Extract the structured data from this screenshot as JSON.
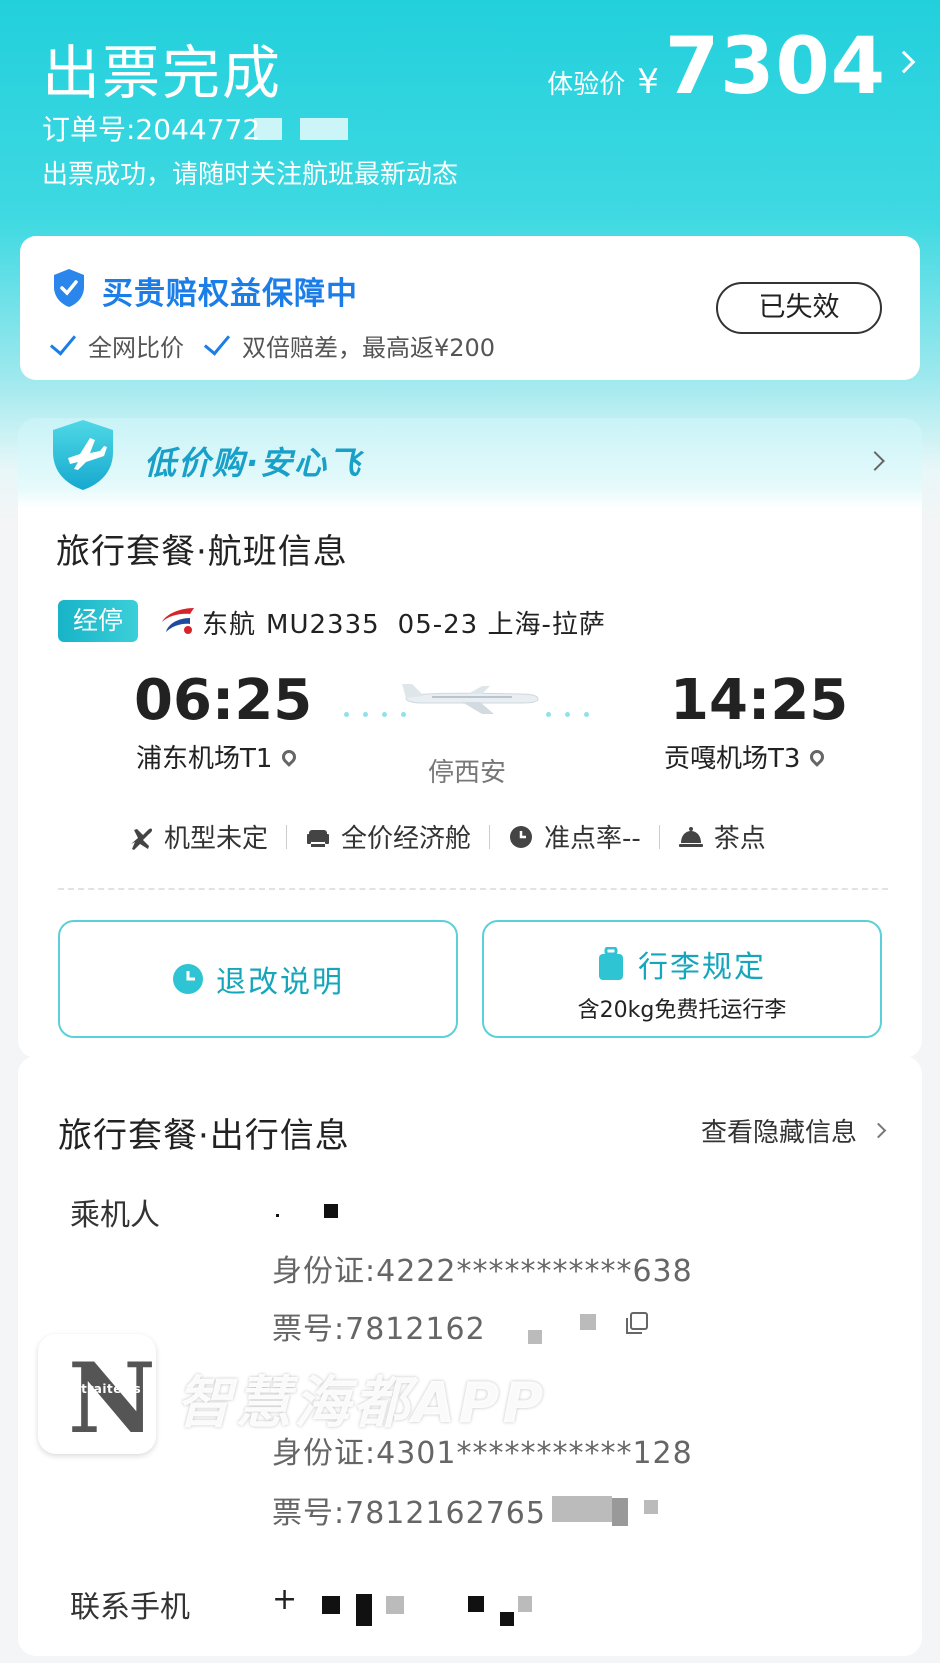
{
  "header": {
    "title": "出票完成",
    "price_label": "体验价",
    "currency": "¥",
    "price": "7304",
    "order_no": "订单号:2044772",
    "subtitle": "出票成功，请随时关注航班最新动态"
  },
  "guarantee": {
    "title": "买贵赔权益保障中",
    "features": [
      "全网比价",
      "双倍赔差，最高返¥200"
    ],
    "status_button": "已失效"
  },
  "banner": {
    "title": "低价购·安心飞"
  },
  "flight_section": {
    "title": "旅行套餐·航班信息",
    "badge": "经停",
    "airline": "东航",
    "flight_no": "MU2335",
    "date_route": "05-23 上海-拉萨",
    "depart_time": "06:25",
    "depart_airport": "浦东机场T1",
    "arrive_time": "14:25",
    "arrive_airport": "贡嘎机场T3",
    "stopover": "停西安",
    "attributes": [
      {
        "icon": "plane-icon",
        "label": "机型未定"
      },
      {
        "icon": "seat-icon",
        "label": "全价经济舱"
      },
      {
        "icon": "clock-icon",
        "label": "准点率--"
      },
      {
        "icon": "meal-icon",
        "label": "茶点"
      }
    ],
    "refund_button": "退改说明",
    "baggage_button": "行李规定",
    "baggage_sub": "含20kg免费托运行李"
  },
  "trip_section": {
    "title": "旅行套餐·出行信息",
    "view_hidden": "查看隐藏信息",
    "passenger_label": "乘机人",
    "passengers": [
      {
        "id_label": "身份证:",
        "id_value": "4222***********638",
        "ticket_label": "票号:",
        "ticket_value": "7812162"
      },
      {
        "id_label": "身份证:",
        "id_value": "4301***********128",
        "ticket_label": "票号:",
        "ticket_value": "7812162765"
      }
    ],
    "contact_label": "联系手机",
    "contact_value": "+"
  },
  "watermark": {
    "logo_letter": "N",
    "logo_small": "Straitews",
    "text": "智慧海都APP"
  },
  "colors": {
    "accent": "#22d0dc",
    "teal_text": "#15a6bc",
    "blue": "#1b7de8"
  }
}
